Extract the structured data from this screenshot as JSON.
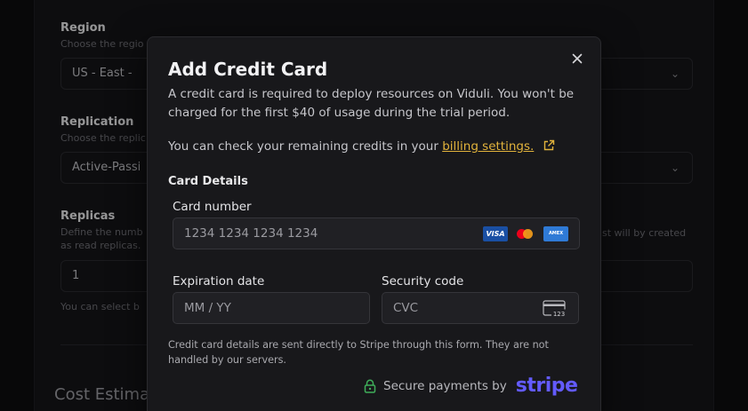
{
  "background": {
    "region": {
      "label": "Region",
      "help": "Choose the regio",
      "value": "US - East -"
    },
    "replication": {
      "label": "Replication",
      "help": "Choose the replic",
      "value": "Active-Passi"
    },
    "replicas": {
      "label": "Replicas",
      "help_line1": "Define the numb",
      "help_line2": "as read replicas.",
      "right_help": "st will by created",
      "value": "1",
      "footer_help": "You can select b"
    },
    "cost_title": "Cost Estima"
  },
  "modal": {
    "title": "Add Credit Card",
    "description": "A credit card is required to deploy resources on Viduli. You won't be charged for the first $40 of usage during the trial period.",
    "credits_text": "You can check your remaining credits in your ",
    "credits_link": "billing settings.",
    "section_title": "Card Details",
    "card_number": {
      "label": "Card number",
      "placeholder": "1234 1234 1234 1234"
    },
    "brands": {
      "visa": "VISA",
      "amex": "AMEX"
    },
    "expiration": {
      "label": "Expiration date",
      "placeholder": "MM / YY"
    },
    "security": {
      "label": "Security code",
      "placeholder": "CVC",
      "icon_text": "123"
    },
    "disclaimer": "Credit card details are sent directly to Stripe through this form. They are not handled by our servers.",
    "secure_text": "Secure payments by",
    "stripe_logo": "stripe"
  },
  "colors": {
    "accent_link": "#e2b33c",
    "stripe": "#635bff",
    "lock": "#3fae5a"
  }
}
